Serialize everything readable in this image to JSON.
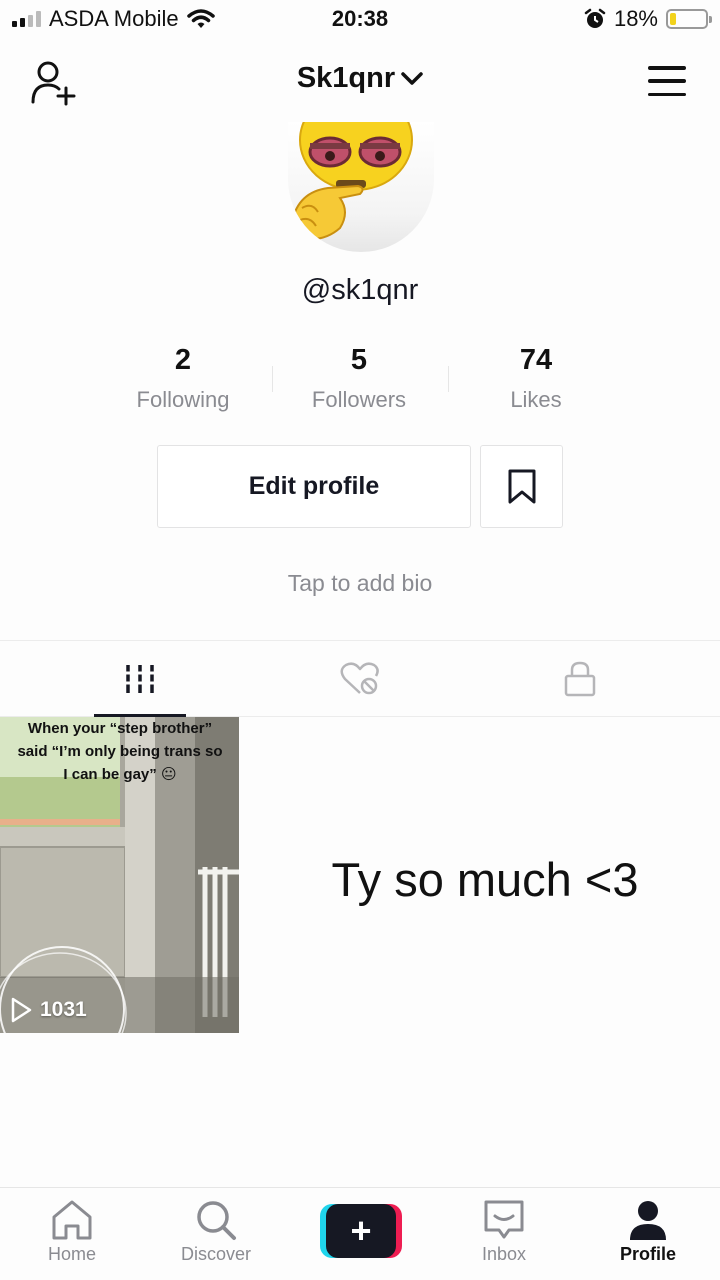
{
  "status_bar": {
    "carrier": "ASDA Mobile",
    "time": "20:38",
    "battery_percent": "18%",
    "battery_level": 0.18
  },
  "header": {
    "username": "Sk1qnr"
  },
  "profile": {
    "handle": "@sk1qnr",
    "stats": [
      {
        "value": "2",
        "label": "Following"
      },
      {
        "value": "5",
        "label": "Followers"
      },
      {
        "value": "74",
        "label": "Likes"
      }
    ],
    "edit_profile_label": "Edit profile",
    "bio_placeholder": "Tap to add bio"
  },
  "videos": [
    {
      "caption": "When your “step brother” said “I’m only being trans so I can be gay” 😐",
      "views": "1031"
    }
  ],
  "overlay_text": "Ty so much <3",
  "bottom_nav": [
    {
      "label": "Home"
    },
    {
      "label": "Discover"
    },
    {
      "label": "Inbox"
    },
    {
      "label": "Profile"
    }
  ],
  "colors": {
    "accent_cyan": "#20d5ec",
    "accent_red": "#ee1d52",
    "text_primary": "#161823",
    "text_secondary": "#8a8b91",
    "battery_yellow": "#f2d21b"
  }
}
